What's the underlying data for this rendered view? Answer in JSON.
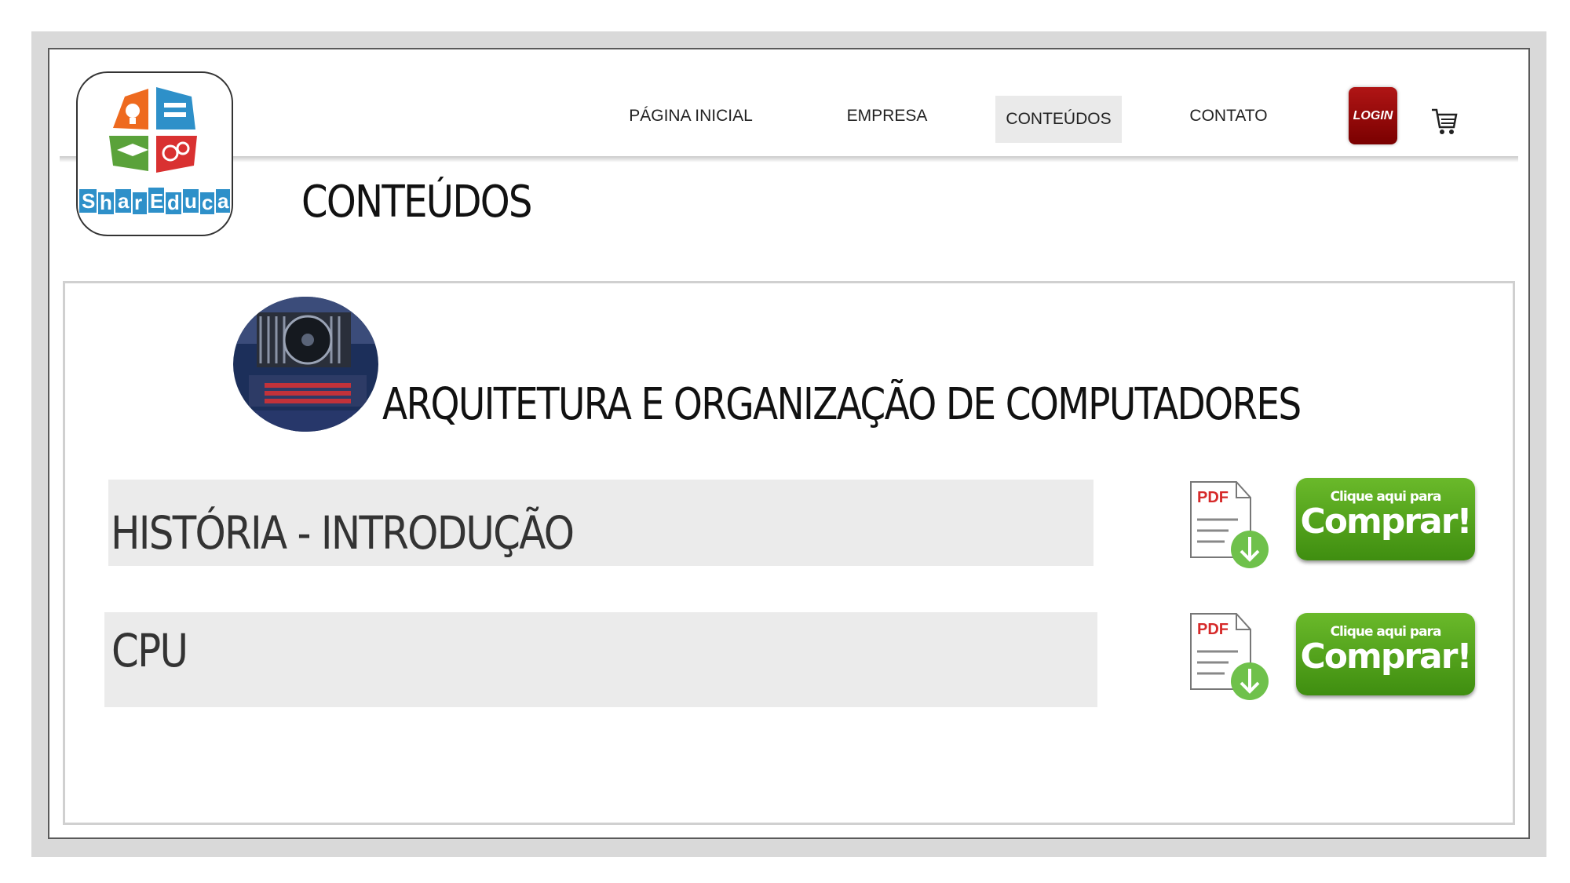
{
  "brand": {
    "logo_text": "ShareEduca"
  },
  "nav": {
    "items": [
      {
        "label": "PÁGINA INICIAL"
      },
      {
        "label": "EMPRESA"
      },
      {
        "label": "CONTEÚDOS",
        "active": true
      },
      {
        "label": "CONTATO"
      }
    ],
    "login_label": "LOGIN",
    "cart_icon": "cart-icon"
  },
  "page": {
    "title": "CONTEÚDOS"
  },
  "course": {
    "title": "ARQUITETURA E ORGANIZAÇÃO DE COMPUTADORES",
    "lessons": [
      {
        "label": "HISTÓRIA - INTRODUÇÃO"
      },
      {
        "label": "CPU"
      }
    ]
  },
  "pdf_icon": {
    "label": "PDF"
  },
  "buy_button": {
    "small_label": "Clique aqui para",
    "big_label": "Comprar!"
  },
  "colors": {
    "login_red": "#9a0d0d",
    "buy_green": "#4f9f1a",
    "active_nav_bg": "#eaeaea"
  }
}
